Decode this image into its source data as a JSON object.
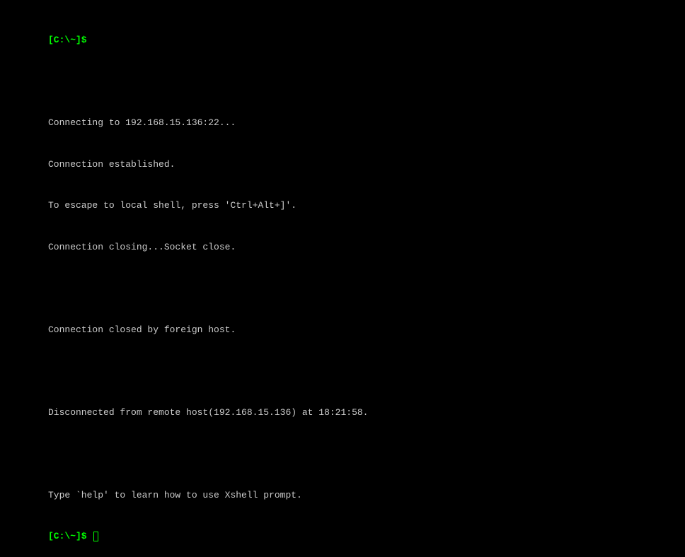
{
  "terminal": {
    "prompt1": "[C:\\~]$ ",
    "lines": {
      "l1": "Connecting to 192.168.15.136:22...",
      "l2": "Connection established.",
      "l3": "To escape to local shell, press 'Ctrl+Alt+]'.",
      "l4": "Connection closing...Socket close.",
      "l5": "Connection closed by foreign host.",
      "l6": "Disconnected from remote host(192.168.15.136) at 18:21:58.",
      "l7": "Type `help' to learn how to use Xshell prompt."
    },
    "prompt2": "[C:\\~]$ "
  }
}
